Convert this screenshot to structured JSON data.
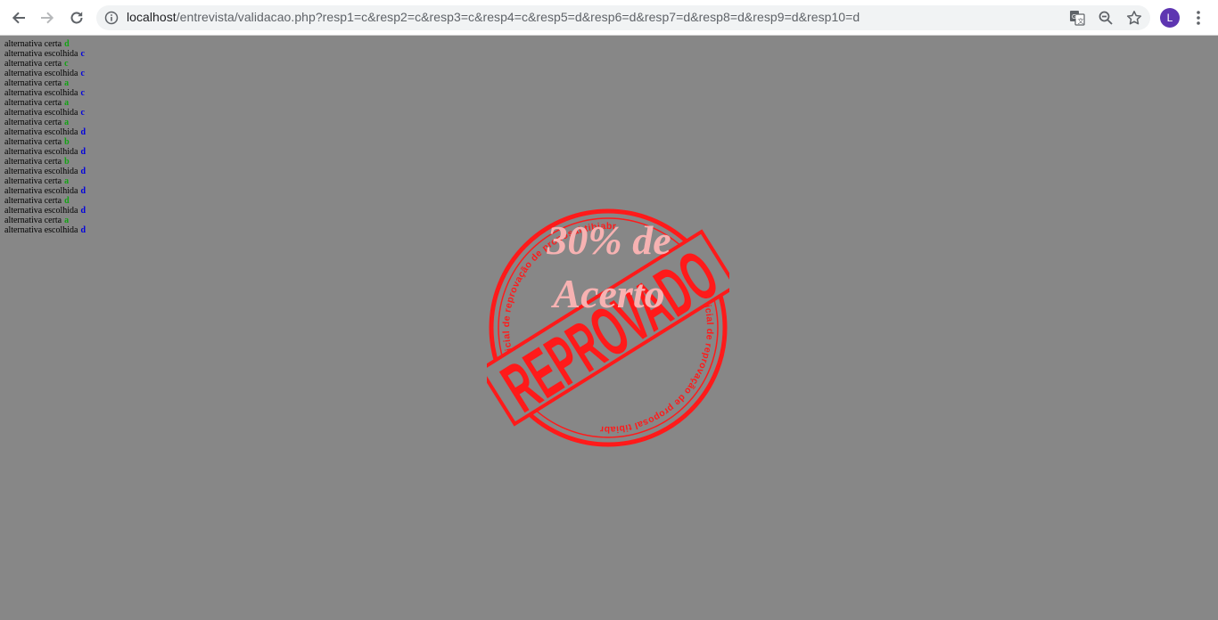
{
  "browser": {
    "url_host": "localhost",
    "url_path": "/entrevista/validacao.php?resp1=c&resp2=c&resp3=c&resp4=c&resp5=d&resp6=d&resp7=d&resp8=d&resp9=d&resp10=d",
    "profile_initial": "L",
    "icons": [
      "back-arrow-icon",
      "forward-arrow-icon",
      "reload-icon",
      "info-icon",
      "translate-icon",
      "zoom-icon",
      "star-icon",
      "more-vertical-icon"
    ]
  },
  "results": {
    "correct_label": "alternativa certa",
    "chosen_label": "alternativa escolhida",
    "answers": [
      {
        "correct": "d",
        "chosen": "c"
      },
      {
        "correct": "c",
        "chosen": "c"
      },
      {
        "correct": "a",
        "chosen": "c"
      },
      {
        "correct": "a",
        "chosen": "c"
      },
      {
        "correct": "a",
        "chosen": "d"
      },
      {
        "correct": "b",
        "chosen": "d"
      },
      {
        "correct": "b",
        "chosen": "d"
      },
      {
        "correct": "a",
        "chosen": "d"
      },
      {
        "correct": "d",
        "chosen": "d"
      },
      {
        "correct": "a",
        "chosen": "d"
      }
    ]
  },
  "stamp": {
    "score_text": "30% de Acerto",
    "seal_word": "REPROVADO",
    "ring_text_top": "selo oficial de reprovação de proposal tibiabr",
    "ring_text_bottom": "selo oficial de reprovação de proposal tibiabr",
    "color": "#ff1a1a"
  },
  "colors": {
    "page_background": "#878787",
    "correct_letter": "#12a312",
    "chosen_letter": "#0000dd"
  }
}
